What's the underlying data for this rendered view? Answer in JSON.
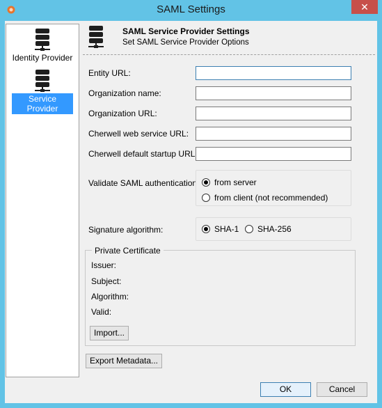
{
  "window": {
    "title": "SAML Settings",
    "close_glyph": "✕"
  },
  "nav": {
    "items": [
      {
        "label": "Identity Provider",
        "icon": "server-icon",
        "selected": false
      },
      {
        "label": "Service Provider",
        "icon": "server-icon",
        "selected": true
      }
    ]
  },
  "header": {
    "title": "SAML Service Provider Settings",
    "subtitle": "Set SAML Service Provider Options"
  },
  "form": {
    "entity_url": {
      "label": "Entity URL:",
      "value": ""
    },
    "org_name": {
      "label": "Organization name:",
      "value": ""
    },
    "org_url": {
      "label": "Organization URL:",
      "value": ""
    },
    "web_service_url": {
      "label": "Cherwell web service URL:",
      "value": ""
    },
    "startup_url": {
      "label": "Cherwell default startup URL:",
      "value": ""
    },
    "validate": {
      "label": "Validate SAML authentication:",
      "options": [
        {
          "label": "from server",
          "checked": true
        },
        {
          "label": "from client (not recommended)",
          "checked": false
        }
      ]
    },
    "signature": {
      "label": "Signature algorithm:",
      "options": [
        {
          "label": "SHA-1",
          "checked": true
        },
        {
          "label": "SHA-256",
          "checked": false
        }
      ]
    }
  },
  "certificate": {
    "legend": "Private Certificate",
    "issuer": "Issuer:",
    "subject": "Subject:",
    "algorithm": "Algorithm:",
    "valid": "Valid:",
    "import_label": "Import..."
  },
  "buttons": {
    "export_label": "Export Metadata...",
    "ok_label": "OK",
    "cancel_label": "Cancel"
  },
  "colors": {
    "titlebar": "#62c3e6",
    "close": "#c7504a",
    "selection": "#3399ff"
  }
}
